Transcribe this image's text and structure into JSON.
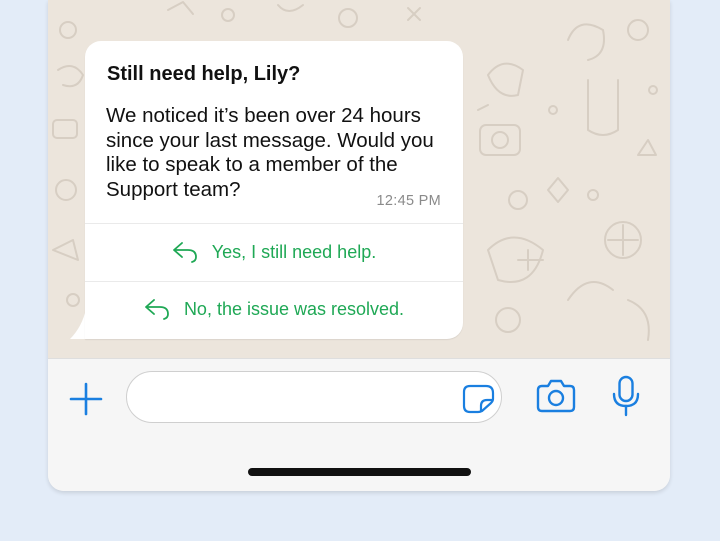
{
  "message": {
    "title": "Still need help, Lily?",
    "body": "We noticed it’s been over 24 hours since your last message. Would you like to speak to a member of the Support team?",
    "time": "12:45 PM"
  },
  "quick_replies": [
    {
      "label": "Yes, I still need help.",
      "icon": "reply-arrow-icon"
    },
    {
      "label": "No, the issue was resolved.",
      "icon": "reply-arrow-icon"
    }
  ],
  "composer": {
    "input_value": "",
    "icons": [
      "plus-icon",
      "sticker-icon",
      "camera-icon",
      "microphone-icon"
    ]
  },
  "colors": {
    "page_background": "#e3ecf8",
    "chat_background": "#ece5dc",
    "reply_green": "#1fa855",
    "icon_blue": "#1a7fe0"
  }
}
